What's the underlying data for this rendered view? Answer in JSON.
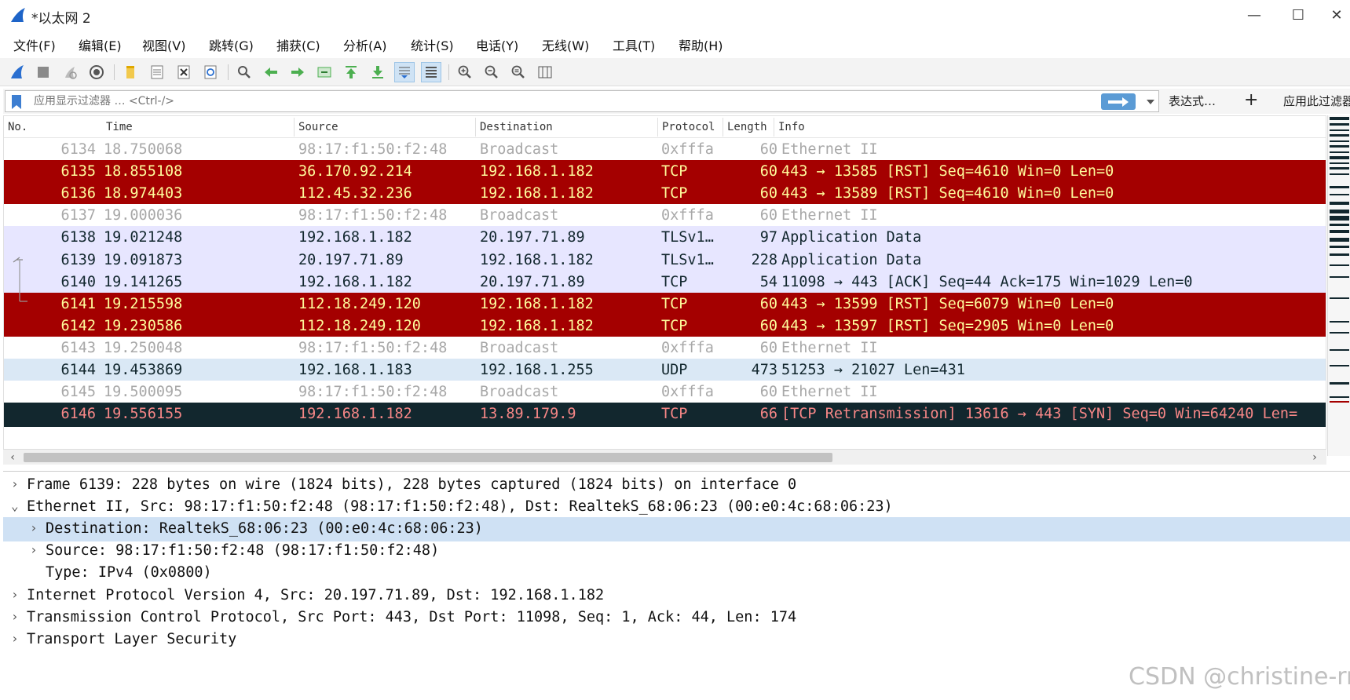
{
  "window": {
    "title": "*以太网 2",
    "controls": {
      "minimize": "—",
      "maximize": "☐",
      "close": "✕"
    }
  },
  "menu": [
    "文件(F)",
    "编辑(E)",
    "视图(V)",
    "跳转(G)",
    "捕获(C)",
    "分析(A)",
    "统计(S)",
    "电话(Y)",
    "无线(W)",
    "工具(T)",
    "帮助(H)"
  ],
  "toolbar": {
    "icons": [
      "shark-fin-start-icon",
      "stop-capture-icon",
      "restart-capture-icon",
      "capture-options-icon",
      "open-file-icon",
      "save-file-icon",
      "close-file-icon",
      "reload-file-icon",
      "find-packet-icon",
      "go-back-icon",
      "go-forward-icon",
      "go-to-packet-icon",
      "go-first-icon",
      "go-last-icon",
      "auto-scroll-icon",
      "colorize-icon",
      "zoom-in-icon",
      "zoom-out-icon",
      "normal-size-icon",
      "resize-columns-icon"
    ]
  },
  "filter": {
    "placeholder": "应用显示过滤器 … <Ctrl-/>",
    "expression_label": "表达式…",
    "add_label": "+",
    "apply_label": "应用此过滤器"
  },
  "packet_list": {
    "columns": [
      "No.",
      "Time",
      "Source",
      "Destination",
      "Protocol",
      "Length",
      "Info"
    ],
    "rows": [
      {
        "no": "6134",
        "time": "18.750068",
        "src": "98:17:f1:50:f2:48",
        "dst": "Broadcast",
        "proto": "0xfffa",
        "len": "60",
        "info": "Ethernet II",
        "style": "gray"
      },
      {
        "no": "6135",
        "time": "18.855108",
        "src": "36.170.92.214",
        "dst": "192.168.1.182",
        "proto": "TCP",
        "len": "60",
        "info": "443 → 13585 [RST] Seq=4610 Win=0 Len=0",
        "style": "red"
      },
      {
        "no": "6136",
        "time": "18.974403",
        "src": "112.45.32.236",
        "dst": "192.168.1.182",
        "proto": "TCP",
        "len": "60",
        "info": "443 → 13589 [RST] Seq=4610 Win=0 Len=0",
        "style": "red"
      },
      {
        "no": "6137",
        "time": "19.000036",
        "src": "98:17:f1:50:f2:48",
        "dst": "Broadcast",
        "proto": "0xfffa",
        "len": "60",
        "info": "Ethernet II",
        "style": "gray"
      },
      {
        "no": "6138",
        "time": "19.021248",
        "src": "192.168.1.182",
        "dst": "20.197.71.89",
        "proto": "TLSv1…",
        "len": "97",
        "info": "Application Data",
        "style": "lav"
      },
      {
        "no": "6139",
        "time": "19.091873",
        "src": "20.197.71.89",
        "dst": "192.168.1.182",
        "proto": "TLSv1…",
        "len": "228",
        "info": "Application Data",
        "style": "selected"
      },
      {
        "no": "6140",
        "time": "19.141265",
        "src": "192.168.1.182",
        "dst": "20.197.71.89",
        "proto": "TCP",
        "len": "54",
        "info": "11098 → 443 [ACK] Seq=44 Ack=175 Win=1029 Len=0",
        "style": "lav"
      },
      {
        "no": "6141",
        "time": "19.215598",
        "src": "112.18.249.120",
        "dst": "192.168.1.182",
        "proto": "TCP",
        "len": "60",
        "info": "443 → 13599 [RST] Seq=6079 Win=0 Len=0",
        "style": "red"
      },
      {
        "no": "6142",
        "time": "19.230586",
        "src": "112.18.249.120",
        "dst": "192.168.1.182",
        "proto": "TCP",
        "len": "60",
        "info": "443 → 13597 [RST] Seq=2905 Win=0 Len=0",
        "style": "red"
      },
      {
        "no": "6143",
        "time": "19.250048",
        "src": "98:17:f1:50:f2:48",
        "dst": "Broadcast",
        "proto": "0xfffa",
        "len": "60",
        "info": "Ethernet II",
        "style": "gray"
      },
      {
        "no": "6144",
        "time": "19.453869",
        "src": "192.168.1.183",
        "dst": "192.168.1.255",
        "proto": "UDP",
        "len": "473",
        "info": "51253 → 21027 Len=431",
        "style": "lightblue"
      },
      {
        "no": "6145",
        "time": "19.500095",
        "src": "98:17:f1:50:f2:48",
        "dst": "Broadcast",
        "proto": "0xfffa",
        "len": "60",
        "info": "Ethernet II",
        "style": "gray"
      },
      {
        "no": "6146",
        "time": "19.556155",
        "src": "192.168.1.182",
        "dst": "13.89.179.9",
        "proto": "TCP",
        "len": "66",
        "info": "[TCP Retransmission] 13616 → 443 [SYN] Seq=0 Win=64240 Len=",
        "style": "dark"
      }
    ]
  },
  "details": [
    {
      "text": "Frame 6139: 228 bytes on wire (1824 bits), 228 bytes captured (1824 bits) on interface 0",
      "arrow": "›",
      "indent": 0,
      "selected": false
    },
    {
      "text": "Ethernet II, Src: 98:17:f1:50:f2:48 (98:17:f1:50:f2:48), Dst: RealtekS_68:06:23 (00:e0:4c:68:06:23)",
      "arrow": "⌄",
      "indent": 0,
      "selected": false
    },
    {
      "text": "Destination: RealtekS_68:06:23 (00:e0:4c:68:06:23)",
      "arrow": "›",
      "indent": 1,
      "selected": true
    },
    {
      "text": "Source: 98:17:f1:50:f2:48 (98:17:f1:50:f2:48)",
      "arrow": "›",
      "indent": 1,
      "selected": false
    },
    {
      "text": "Type: IPv4 (0x0800)",
      "arrow": "",
      "indent": 1,
      "selected": false
    },
    {
      "text": "Internet Protocol Version 4, Src: 20.197.71.89, Dst: 192.168.1.182",
      "arrow": "›",
      "indent": 0,
      "selected": false
    },
    {
      "text": "Transmission Control Protocol, Src Port: 443, Dst Port: 11098, Seq: 1, Ack: 44, Len: 174",
      "arrow": "›",
      "indent": 0,
      "selected": false
    },
    {
      "text": "Transport Layer Security",
      "arrow": "›",
      "indent": 0,
      "selected": false
    }
  ],
  "watermark": "CSDN @christine-rr",
  "colors": {
    "rst_red": "#a40000",
    "tcp_lavender": "#e7e6ff",
    "udp_blue": "#dae8f5",
    "bad_dark": "#12272e",
    "selected_detail": "#cfe1f4"
  }
}
